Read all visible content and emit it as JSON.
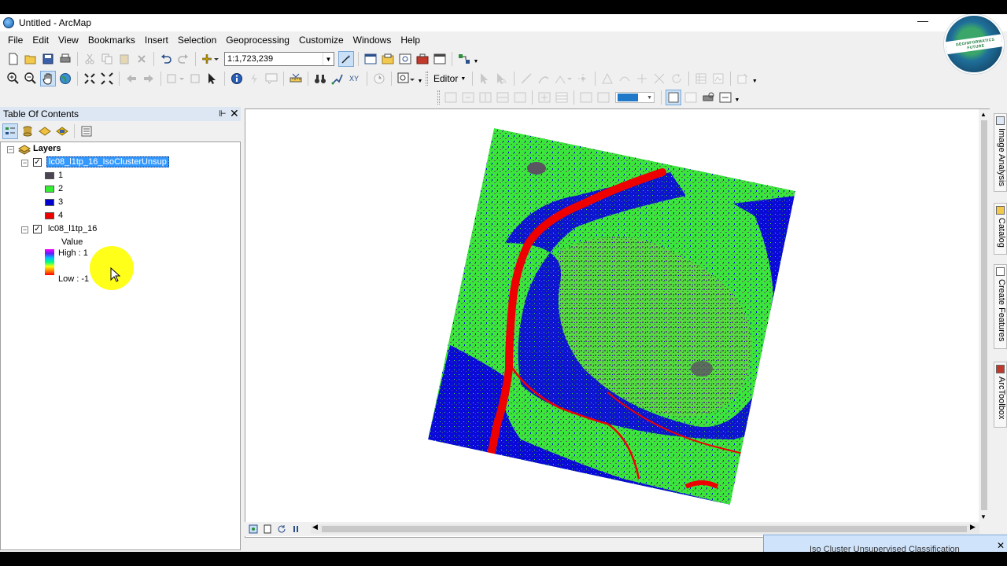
{
  "window": {
    "title": "Untitled - ArcMap",
    "minimize": "—"
  },
  "logo": {
    "text": "GEOINFORMATICS FUTURE"
  },
  "menu": [
    "File",
    "Edit",
    "View",
    "Bookmarks",
    "Insert",
    "Selection",
    "Geoprocessing",
    "Customize",
    "Windows",
    "Help"
  ],
  "toolbar": {
    "scale": "1:1,723,239",
    "editor_label": "Editor"
  },
  "toc": {
    "title": "Table Of Contents",
    "root": "Layers",
    "layer1": {
      "name": "lc08_l1tp_16_IsoClusterUnsup",
      "classes": [
        {
          "label": "1",
          "color": "#4a4550"
        },
        {
          "label": "2",
          "color": "#33ee33"
        },
        {
          "label": "3",
          "color": "#0000d0"
        },
        {
          "label": "4",
          "color": "#ee0000"
        }
      ]
    },
    "layer2": {
      "name": "lc08_l1tp_16",
      "value_label": "Value",
      "high": "High : 1",
      "low": "Low : -1"
    }
  },
  "dock_tabs": [
    "Image Analysis",
    "Catalog",
    "Create Features",
    "ArcToolbox"
  ],
  "popup": {
    "text": "Iso Cluster Unsupervised Classification"
  },
  "colors": {
    "accent": "#3399ff",
    "toc_header": "#dde7f3"
  }
}
